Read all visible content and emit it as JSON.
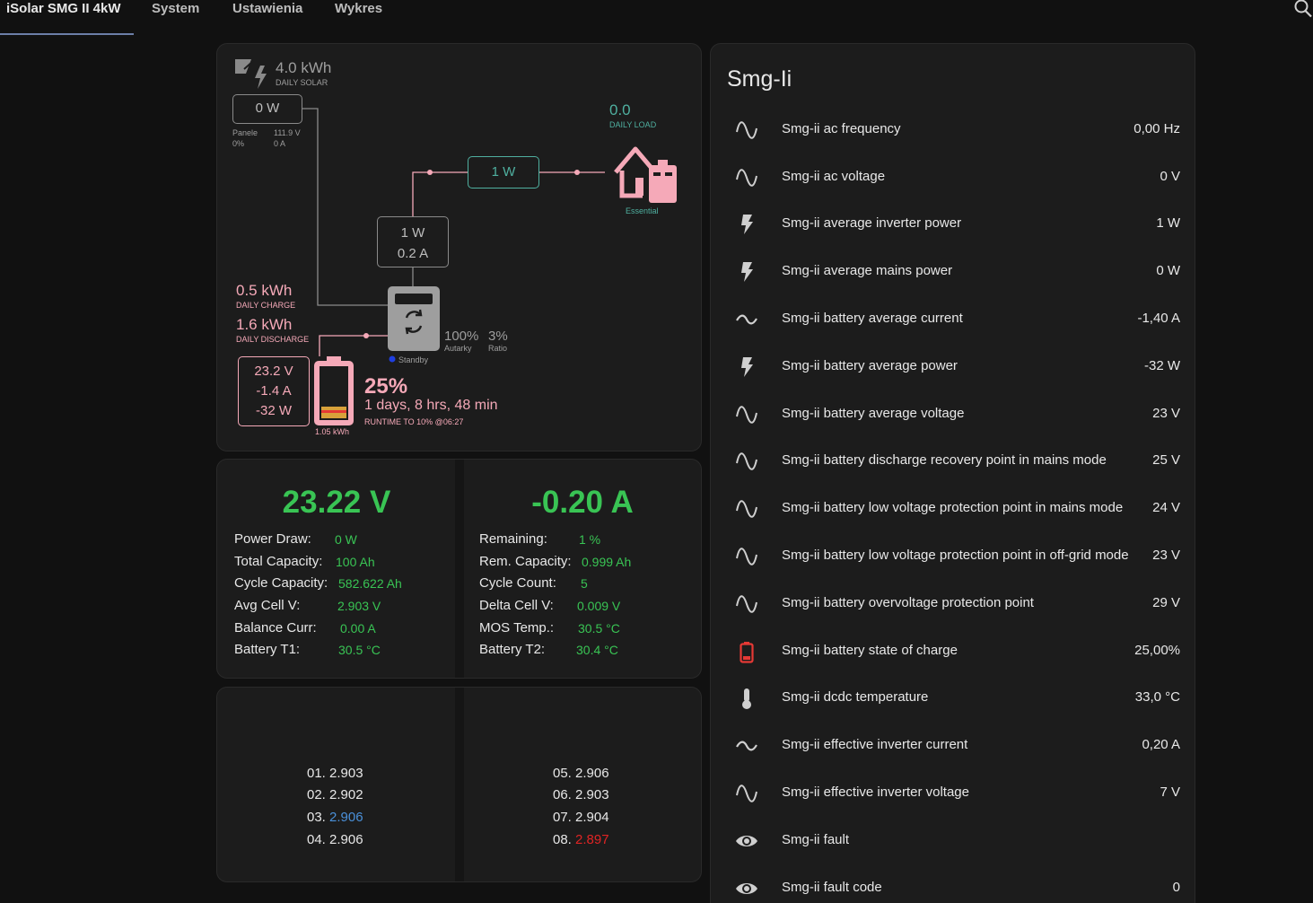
{
  "tabs": [
    {
      "label": "iSolar SMG II 4kW"
    },
    {
      "label": "System"
    },
    {
      "label": "Ustawienia"
    },
    {
      "label": "Wykres"
    }
  ],
  "flow": {
    "solar_daily": "4.0 kWh",
    "solar_daily_label": "DAILY SOLAR",
    "pv_power": "0 W",
    "pv_name": "Panele",
    "pv_voltage": "111.9 V",
    "pv_percent": "0%",
    "pv_current": "0 A",
    "load_daily": "0.0",
    "load_daily_label": "DAILY LOAD",
    "essential_power": "1 W",
    "essential_label": "Essential",
    "inverter_power": "1 W",
    "inverter_current": "0.2 A",
    "daily_charge": "0.5 kWh",
    "daily_charge_label": "DAILY CHARGE",
    "daily_discharge": "1.6 kWh",
    "daily_discharge_label": "DAILY DISCHARGE",
    "autarky_value": "100%",
    "autarky_label": "Autarky",
    "ratio_value": "3%",
    "ratio_label": "Ratio",
    "status": "Standby",
    "battery_voltage": "23.2 V",
    "battery_current": "-1.4 A",
    "battery_power": "-32 W",
    "battery_soc": "25%",
    "battery_soc_fraction": 0.25,
    "battery_runtime": "1 days, 8 hrs, 48 min",
    "battery_runtime_label": "RUNTIME TO 10% @06:27",
    "battery_energy": "1.05 kWh",
    "colors": {
      "solar": "#8a8a8a",
      "load": "#4fb0a0",
      "battery": "#f5a9b8",
      "inverter": "#9e9e9e"
    }
  },
  "bms": {
    "voltage": "23.22 V",
    "current": "-0.20 A",
    "left": [
      {
        "k": "Power Draw:",
        "v": "0 W"
      },
      {
        "k": "Total Capacity:",
        "v": "100 Ah"
      },
      {
        "k": "Cycle Capacity:",
        "v": "582.622 Ah"
      },
      {
        "k": "Avg Cell V:",
        "v": "2.903 V"
      },
      {
        "k": "Balance Curr:",
        "v": "0.00 A"
      },
      {
        "k": "Battery T1:",
        "v": "30.5 °C"
      }
    ],
    "right": [
      {
        "k": "Remaining:",
        "v": "1 %"
      },
      {
        "k": "Rem. Capacity:",
        "v": "0.999 Ah"
      },
      {
        "k": "Cycle Count:",
        "v": "5"
      },
      {
        "k": "Delta Cell V:",
        "v": "0.009 V"
      },
      {
        "k": "MOS Temp.:",
        "v": "30.5 °C"
      },
      {
        "k": "Battery T2:",
        "v": "30.4 °C"
      }
    ],
    "cells": [
      {
        "n": "01.",
        "v": "2.903"
      },
      {
        "n": "02.",
        "v": "2.902"
      },
      {
        "n": "03.",
        "v": "2.906"
      },
      {
        "n": "04.",
        "v": "2.906"
      },
      {
        "n": "05.",
        "v": "2.906"
      },
      {
        "n": "06.",
        "v": "2.903"
      },
      {
        "n": "07.",
        "v": "2.904"
      },
      {
        "n": "08.",
        "v": "2.897"
      }
    ]
  },
  "entities": {
    "title": "Smg-Ii",
    "rows": [
      {
        "icon": "sine-wave-icon",
        "name": "Smg-ii ac frequency",
        "value": "0,00 Hz"
      },
      {
        "icon": "sine-wave-icon",
        "name": "Smg-ii ac voltage",
        "value": "0 V"
      },
      {
        "icon": "flash-icon",
        "name": "Smg-ii average inverter power",
        "value": "1 W"
      },
      {
        "icon": "flash-icon",
        "name": "Smg-ii average mains power",
        "value": "0 W"
      },
      {
        "icon": "current-ac-icon",
        "name": "Smg-ii battery average current",
        "value": "-1,40 A"
      },
      {
        "icon": "flash-icon",
        "name": "Smg-ii battery average power",
        "value": "-32 W"
      },
      {
        "icon": "sine-wave-icon",
        "name": "Smg-ii battery average voltage",
        "value": "23 V"
      },
      {
        "icon": "sine-wave-icon",
        "name": "Smg-ii battery discharge recovery point in mains mode",
        "value": "25 V"
      },
      {
        "icon": "sine-wave-icon",
        "name": "Smg-ii battery low voltage protection point in mains mode",
        "value": "24 V"
      },
      {
        "icon": "sine-wave-icon",
        "name": "Smg-ii battery low voltage protection point in off-grid mode",
        "value": "23 V"
      },
      {
        "icon": "sine-wave-icon",
        "name": "Smg-ii battery overvoltage protection point",
        "value": "29 V"
      },
      {
        "icon": "battery-low-icon",
        "name": "Smg-ii battery state of charge",
        "value": "25,00%"
      },
      {
        "icon": "thermometer-icon",
        "name": "Smg-ii dcdc temperature",
        "value": "33,0 °C"
      },
      {
        "icon": "current-ac-icon",
        "name": "Smg-ii effective inverter current",
        "value": "0,20 A"
      },
      {
        "icon": "sine-wave-icon",
        "name": "Smg-ii effective inverter voltage",
        "value": "7 V"
      },
      {
        "icon": "eye-icon",
        "name": "Smg-ii fault",
        "value": ""
      },
      {
        "icon": "eye-icon",
        "name": "Smg-ii fault code",
        "value": "0"
      }
    ]
  }
}
